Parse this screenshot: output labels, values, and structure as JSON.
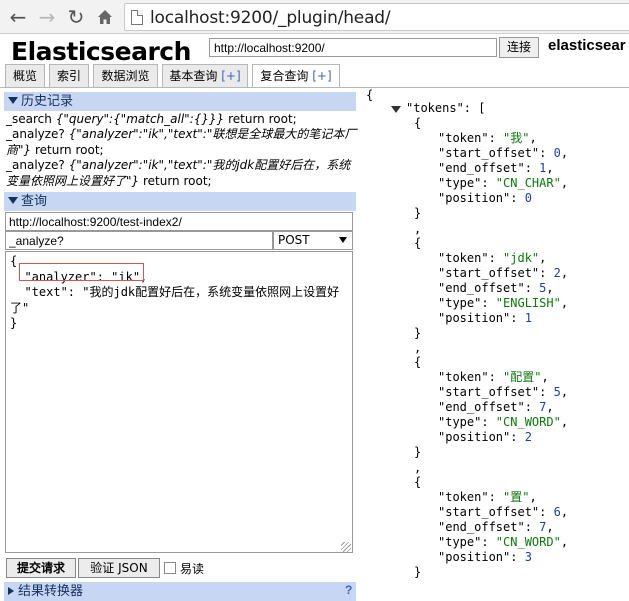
{
  "browser": {
    "url": "localhost:9200/_plugin/head/",
    "icons": {
      "back": "back-arrow-icon",
      "forward": "forward-arrow-icon",
      "reload": "reload-icon",
      "home": "home-icon",
      "page": "page-icon"
    }
  },
  "header": {
    "title": "Elasticsearch",
    "cluster_url": "http://localhost:9200/",
    "connect_label": "连接",
    "cluster_name": "elasticsear"
  },
  "tabs": [
    {
      "label": "概览"
    },
    {
      "label": "索引"
    },
    {
      "label": "数据浏览"
    },
    {
      "label": "基本查询",
      "plus": "[+]"
    },
    {
      "label": "复合查询",
      "plus": "[+]",
      "active": true
    }
  ],
  "history": {
    "title": "历史记录",
    "entries": [
      {
        "prefix": "_search ",
        "query": "{\"query\":{\"match_all\":{}}}",
        "suffix": " return root;"
      },
      {
        "prefix": "_analyze? ",
        "query": "{\"analyzer\":\"ik\",\"text\":\"联想是全球最大的笔记本厂商\"}",
        "suffix": " return root;"
      },
      {
        "prefix": "_analyze? ",
        "query": "{\"analyzer\":\"ik\",\"text\":\"我的jdk配置好后在，系统变量依照网上设置好了\"}",
        "suffix": " return root;"
      }
    ]
  },
  "query": {
    "title": "查询",
    "path": "http://localhost:9200/test-index2/",
    "endpoint": "_analyze?",
    "method": "POST",
    "body_lines": [
      "{",
      "  \"analyzer\": \"ik\",",
      "  \"text\": \"我的jdk配置好后在，系统变量依照网上设置好",
      "了\"",
      "}"
    ],
    "submit_label": "提交请求",
    "validate_label": "验证 JSON",
    "easy_label": "易读"
  },
  "transformer": {
    "title": "结果转换器",
    "help": "?"
  },
  "result": {
    "open_brace": "{",
    "tokens_key": "\"tokens\"",
    "colon_bracket": ": [",
    "tokens": [
      {
        "token": "\"我\"",
        "start_offset": "0",
        "end_offset": "1",
        "type": "\"CN_CHAR\"",
        "position": "0"
      },
      {
        "token": "\"jdk\"",
        "start_offset": "2",
        "end_offset": "5",
        "type": "\"ENGLISH\"",
        "position": "1"
      },
      {
        "token": "\"配置\"",
        "start_offset": "5",
        "end_offset": "7",
        "type": "\"CN_WORD\"",
        "position": "2"
      },
      {
        "token": "\"置\"",
        "start_offset": "6",
        "end_offset": "7",
        "type": "\"CN_WORD\"",
        "position": "3"
      }
    ],
    "keys": {
      "token": "\"token\": ",
      "start_offset": "\"start_offset\": ",
      "end_offset": "\"end_offset\": ",
      "type": "\"type\": ",
      "position": "\"position\": "
    }
  },
  "colors": {
    "section_bg": "#c7d6f3",
    "json_string": "#0a7a0a",
    "json_number": "#1a3fb0",
    "highlight_box": "#d9534f"
  }
}
